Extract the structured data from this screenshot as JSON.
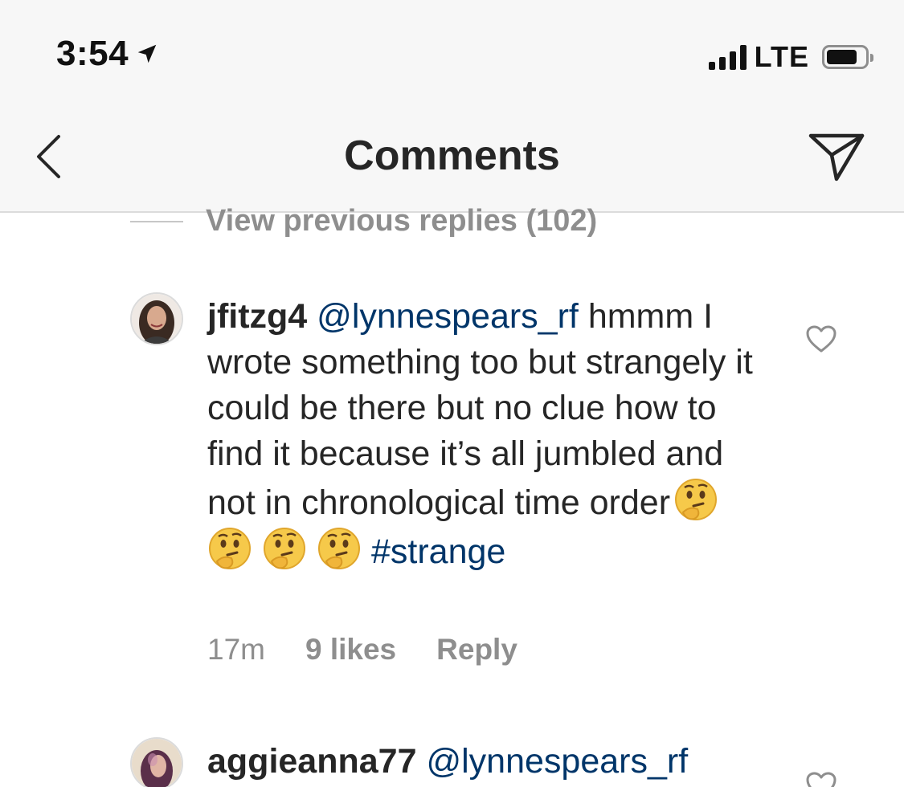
{
  "status_bar": {
    "time": "3:54",
    "network": "LTE",
    "battery_level": 0.8
  },
  "nav": {
    "title": "Comments",
    "back_icon": "chevron-left-icon",
    "share_icon": "paper-plane-icon"
  },
  "thread": {
    "view_previous_label": "View previous replies (102)"
  },
  "comments": [
    {
      "username": "jfitzg4",
      "mention": "@lynnespears_rf",
      "text_1": " hmmm I wrote something too but strangely it could be there but no clue how to find it because it’s all jumbled and not in chronological time order",
      "emoji_name": "thinking-face",
      "emoji_count": 4,
      "hashtag": "#strange",
      "time": "17m",
      "likes": "9 likes",
      "reply_label": "Reply"
    },
    {
      "username": "aggieanna77",
      "mention": "@lynnespears_rf"
    }
  ],
  "colors": {
    "link": "#003569",
    "secondary_text": "#8e8e8e",
    "header_bg": "#f7f7f7"
  }
}
